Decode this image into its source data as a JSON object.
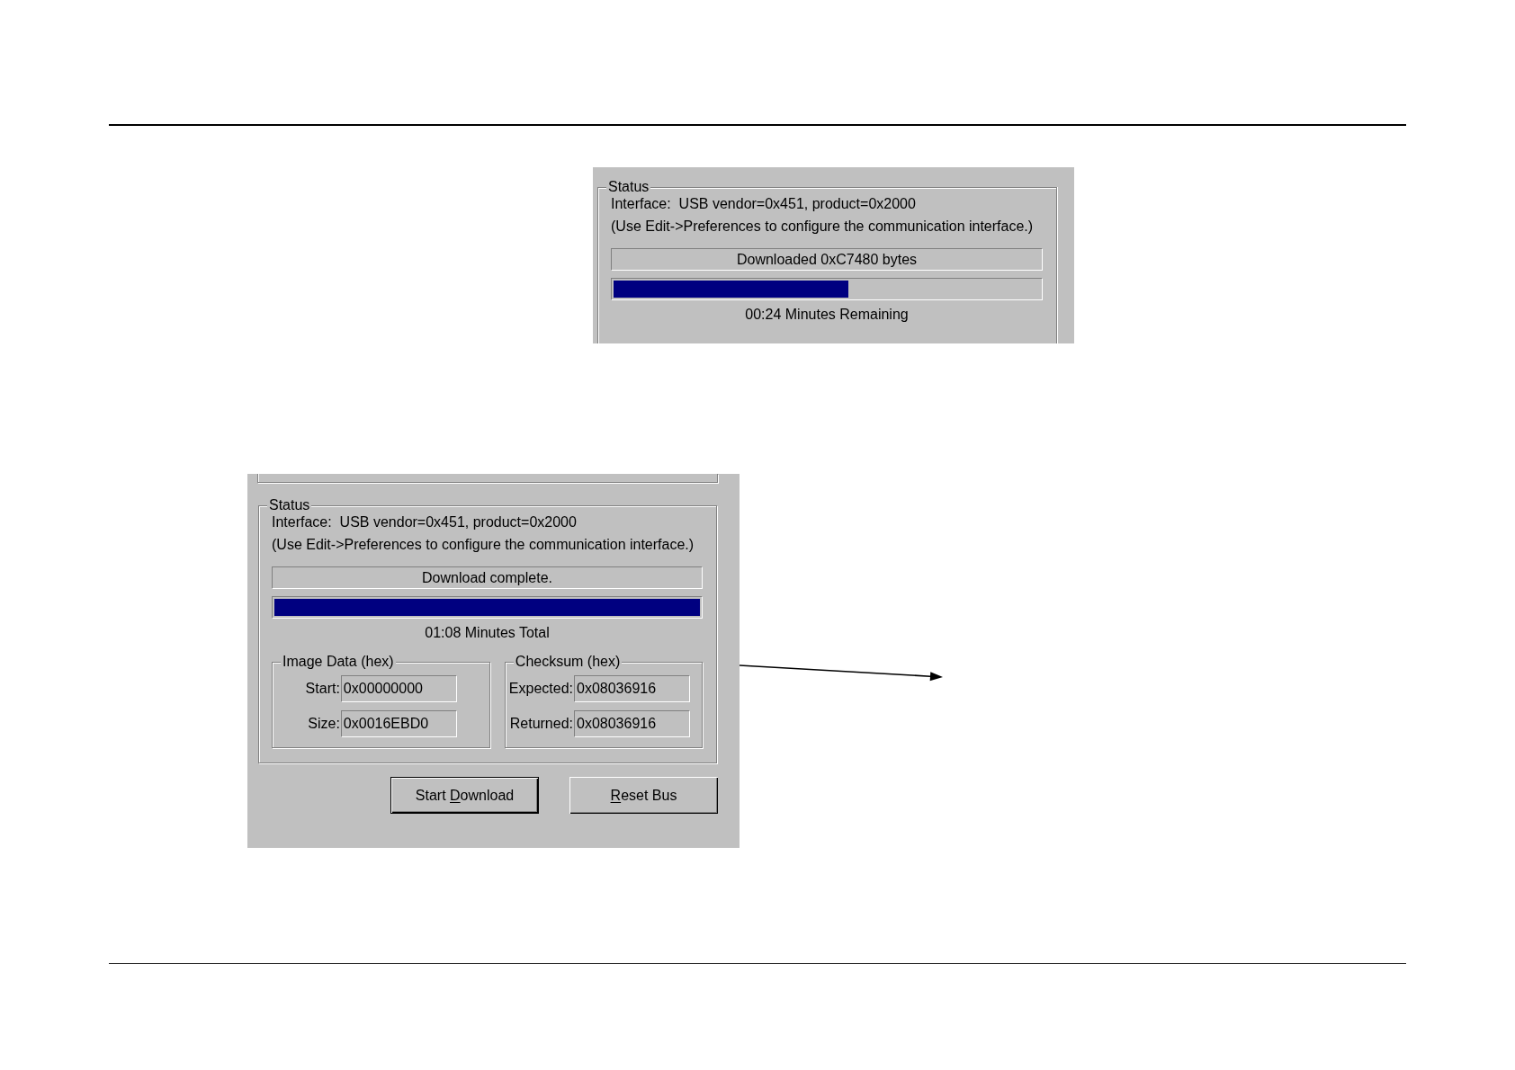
{
  "screenshots": [
    {
      "kind": "progress_crop",
      "status": {
        "title": "Status",
        "interface": "Interface:  USB vendor=0x451, product=0x2000",
        "hint": "(Use Edit->Preferences to configure the communication interface.)",
        "message": "Downloaded 0xC7480 bytes",
        "progress": {
          "level": 0.55
        },
        "time": "00:24 Minutes Remaining"
      }
    },
    {
      "kind": "full_dialog",
      "status": {
        "title": "Status",
        "interface": "Interface:  USB vendor=0x451, product=0x2000",
        "hint": "(Use Edit->Preferences to configure the communication interface.)",
        "message": "Download complete.",
        "progress": {
          "level": 1
        },
        "time": "01:08 Minutes Total",
        "groups": [
          {
            "title": "Image Data (hex)",
            "fields": [
              {
                "label": "Start:",
                "value": "0x00000000"
              },
              {
                "label": "Size:",
                "value": "0x0016EBD0"
              }
            ]
          },
          {
            "title": "Checksum (hex)",
            "fields": [
              {
                "label": "Expected:",
                "value": "0x08036916"
              },
              {
                "label": "Returned:",
                "value": "0x08036916"
              }
            ]
          }
        ]
      },
      "buttons": [
        {
          "label_start": "Start ",
          "access_key": "D",
          "label_end": "ownload",
          "default": true
        },
        {
          "access_key": "R",
          "label_end": "eset Bus",
          "default": false
        }
      ]
    }
  ]
}
